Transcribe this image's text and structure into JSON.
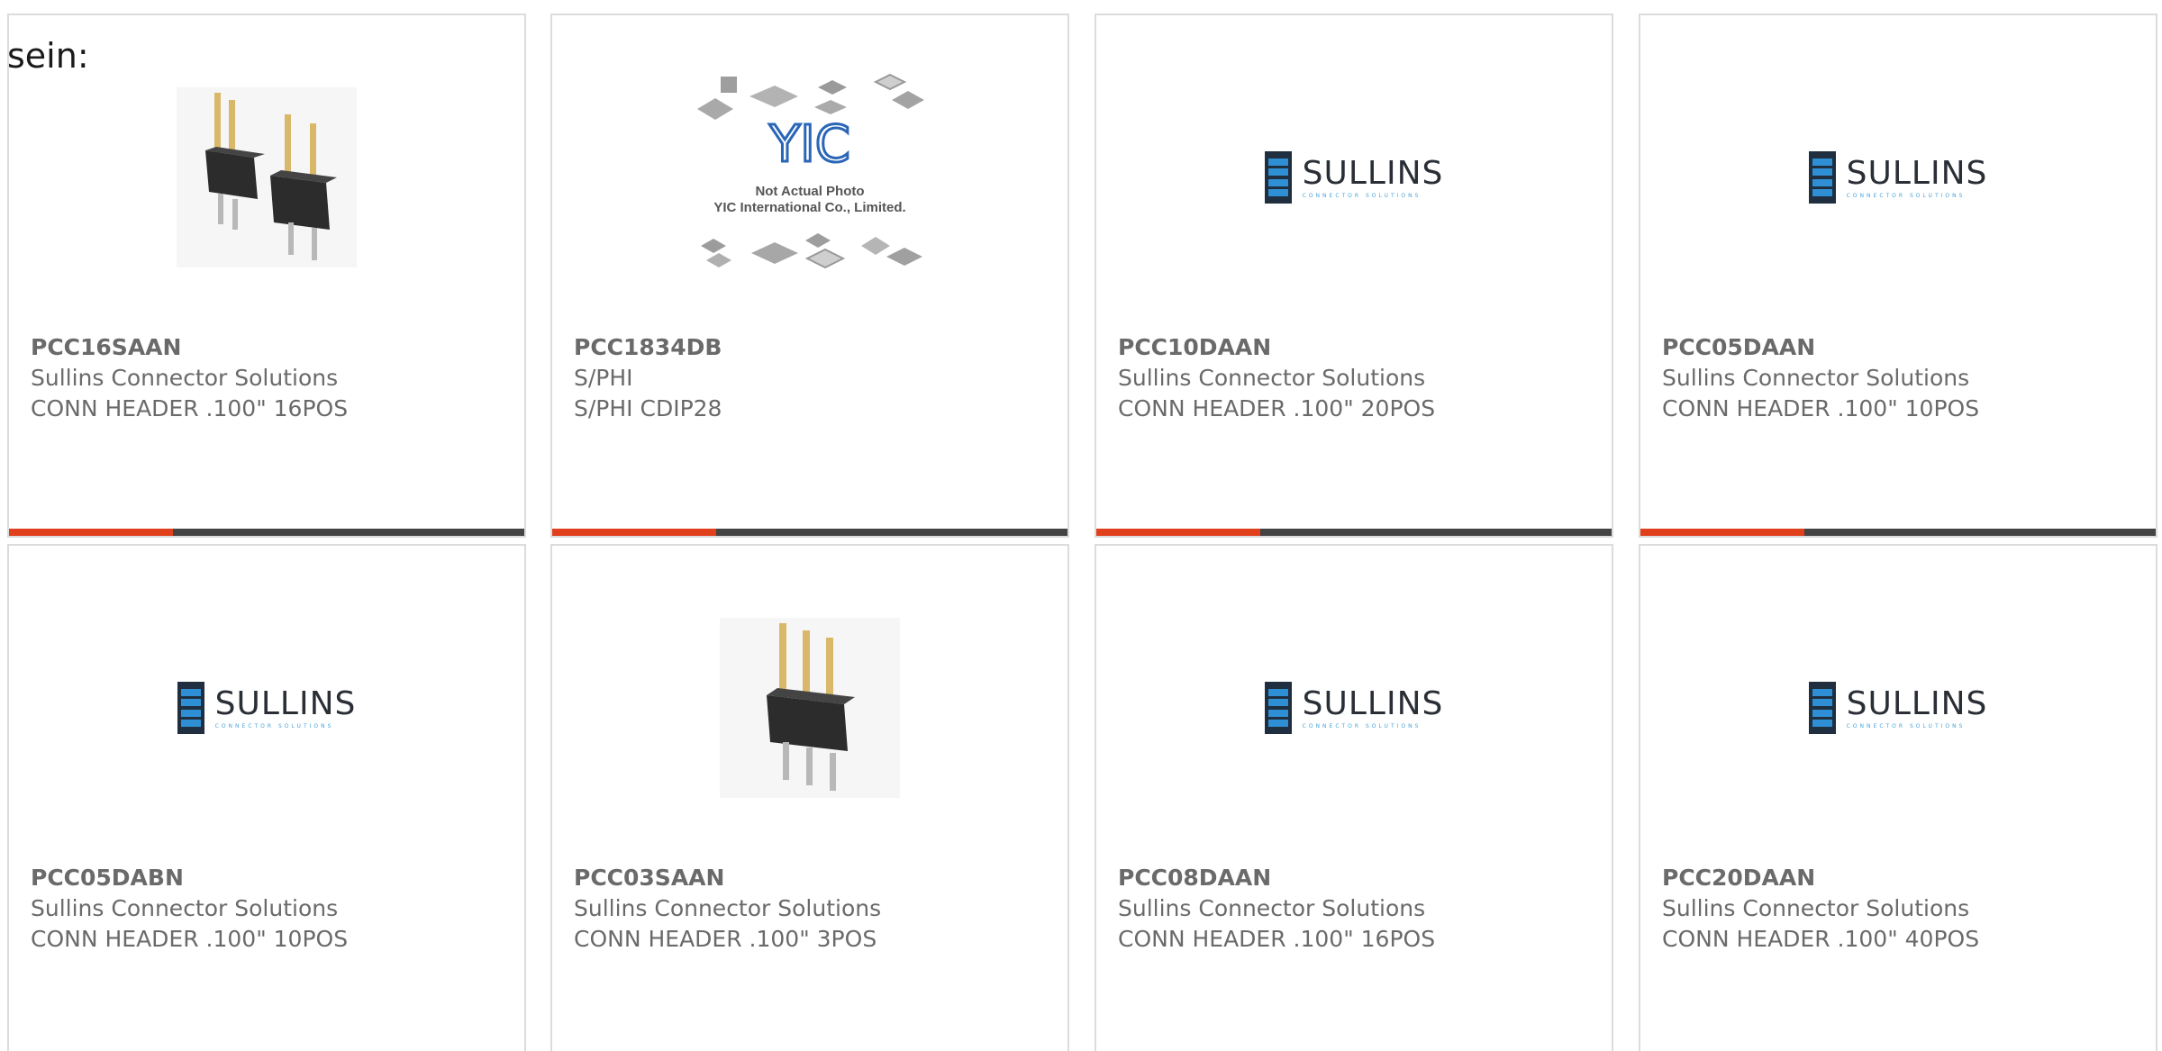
{
  "intro_text": "sein:",
  "colors": {
    "accent": "#e0401c",
    "bar": "#444444",
    "border": "#dcdcdc",
    "text": "#6a6a6a"
  },
  "products": [
    {
      "part_number": "PCC16SAAN",
      "manufacturer": "Sullins Connector Solutions",
      "description": "CONN HEADER .100\" 16POS",
      "image": "pin-header-photo"
    },
    {
      "part_number": "PCC1834DB",
      "manufacturer": "S/PHI",
      "description": "S/PHI CDIP28",
      "image": "not-actual-photo-placeholder",
      "image_text": [
        "Not Actual Photo",
        "YIC International Co., Limited."
      ]
    },
    {
      "part_number": "PCC10DAAN",
      "manufacturer": "Sullins Connector Solutions",
      "description": "CONN HEADER .100\" 20POS",
      "image": "sullins-logo"
    },
    {
      "part_number": "PCC05DAAN",
      "manufacturer": "Sullins Connector Solutions",
      "description": "CONN HEADER .100\" 10POS",
      "image": "sullins-logo"
    },
    {
      "part_number": "PCC05DABN",
      "manufacturer": "Sullins Connector Solutions",
      "description": "CONN HEADER .100\" 10POS",
      "image": "sullins-logo"
    },
    {
      "part_number": "PCC03SAAN",
      "manufacturer": "Sullins Connector Solutions",
      "description": "CONN HEADER .100\" 3POS",
      "image": "pin-header-photo"
    },
    {
      "part_number": "PCC08DAAN",
      "manufacturer": "Sullins Connector Solutions",
      "description": "CONN HEADER .100\" 16POS",
      "image": "sullins-logo"
    },
    {
      "part_number": "PCC20DAAN",
      "manufacturer": "Sullins Connector Solutions",
      "description": "CONN HEADER .100\" 40POS",
      "image": "sullins-logo"
    }
  ],
  "logo": {
    "name": "SULLINS",
    "tagline": "CONNECTOR SOLUTIONS"
  }
}
